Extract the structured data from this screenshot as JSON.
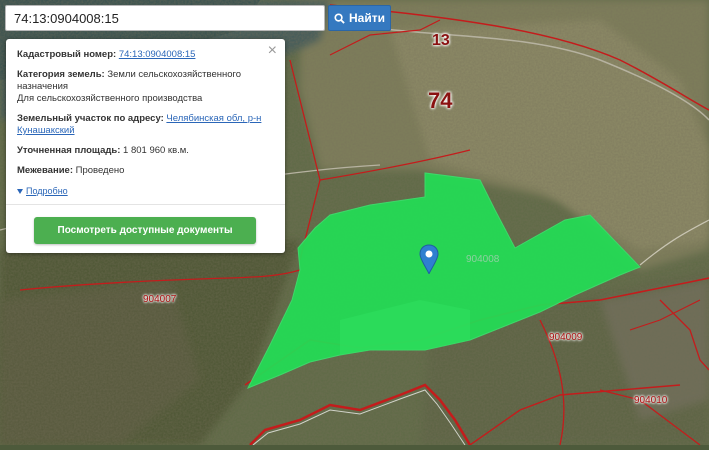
{
  "search": {
    "value": "74:13:0904008:15",
    "button_label": "Найти",
    "icon": "search-icon"
  },
  "popup": {
    "close_label": "×",
    "cadastral_number_label": "Кадастровый номер:",
    "cadastral_number_value": "74:13:0904008:15",
    "land_category_label": "Категория земель:",
    "land_category_value": "Земли сельскохозяйственного назначения",
    "land_use_value": "Для сельскохозяйственного производства",
    "address_label": "Земельный участок по адресу:",
    "address_value": "Челябинская обл, р-н Кунашакский",
    "area_label": "Уточненная площадь:",
    "area_value": "1 801 960 кв.м.",
    "survey_label": "Межевание:",
    "survey_value": "Проведено",
    "more_label": "Подробно",
    "docs_button_label": "Посмотреть доступные документы"
  },
  "map_labels": {
    "region_13": "13",
    "region_74": "74",
    "quarter_904008": "904008",
    "quarter_904007": "904007",
    "quarter_904009": "904009",
    "quarter_904010": "904010"
  },
  "colors": {
    "parcel": "#22dd55",
    "border": "#c41c1c",
    "button": "#4caf50",
    "search_button": "#3579c0",
    "marker": "#2f7fd0"
  }
}
